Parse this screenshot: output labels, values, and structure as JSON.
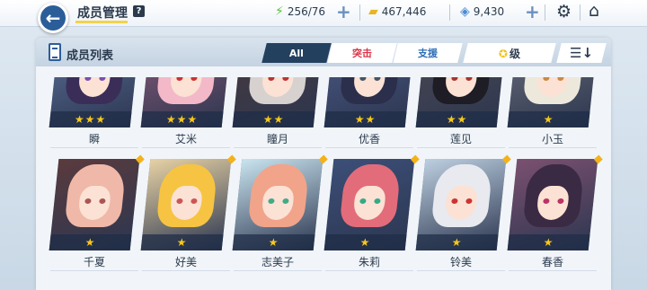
{
  "header": {
    "title": "成员管理",
    "help_label": "?",
    "stamina": "256/76",
    "credits": "467,446",
    "gems": "9,430"
  },
  "panel": {
    "title": "成员列表",
    "tabs": [
      "All",
      "突击",
      "支援"
    ],
    "sort_label": "级",
    "order_label": "☰↓"
  },
  "colors": {
    "accent": "#24405f",
    "assault": "#d8344a",
    "support": "#2f6fb8",
    "star": "#f6c81c"
  },
  "members": [
    {
      "name": "瞬",
      "stars": "★★★",
      "hair": "#3a2e58",
      "bg": "#5b6f98",
      "eye": "#7a4fb0"
    },
    {
      "name": "艾米",
      "stars": "★★★",
      "hair": "#f3b9c8",
      "bg": "#8a5a78",
      "eye": "#c33"
    },
    {
      "name": "瞳月",
      "stars": "★★",
      "hair": "#d7d1cf",
      "bg": "#4b3a3c",
      "eye": "#b33"
    },
    {
      "name": "优香",
      "stars": "★★",
      "hair": "#2b2f4c",
      "bg": "#4c5a86",
      "eye": "#456"
    },
    {
      "name": "莲见",
      "stars": "★★",
      "hair": "#1e1c24",
      "bg": "#4e4a52",
      "eye": "#a33"
    },
    {
      "name": "小玉",
      "stars": "★",
      "hair": "#ede8dc",
      "bg": "#6c6f7a",
      "eye": "#c84"
    },
    {
      "name": "千夏",
      "stars": "★",
      "hair": "#f0b8a8",
      "bg": "#5a3b3e",
      "eye": "#a55"
    },
    {
      "name": "好美",
      "stars": "★",
      "hair": "#f6c442",
      "bg": "#e7d2a5",
      "eye": "#c55"
    },
    {
      "name": "志美子",
      "stars": "★",
      "hair": "#f1a48a",
      "bg": "#c9e4ef",
      "eye": "#4a8"
    },
    {
      "name": "朱莉",
      "stars": "★",
      "hair": "#e36c7a",
      "bg": "#3c4f78",
      "eye": "#3a8"
    },
    {
      "name": "铃美",
      "stars": "★",
      "hair": "#e8eaf0",
      "bg": "#bccfe0",
      "eye": "#c33"
    },
    {
      "name": "春香",
      "stars": "★",
      "hair": "#3b2a44",
      "bg": "#7b5070",
      "eye": "#b36"
    }
  ]
}
